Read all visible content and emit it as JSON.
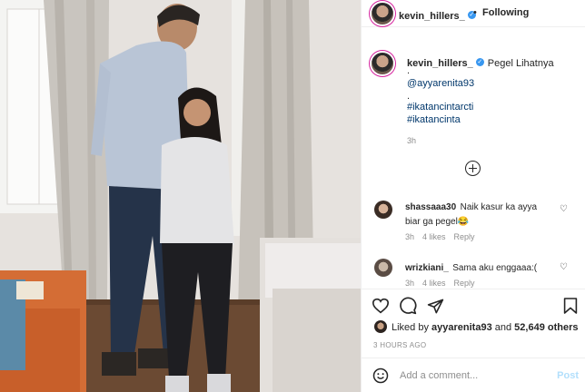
{
  "post": {
    "username": "kevin_hillers_",
    "follow_dot": "•",
    "following_label": "Following",
    "verified_glyph": "✓"
  },
  "caption": {
    "username": "kevin_hillers_",
    "text": "Pegel Lihatnya",
    "dot1": ".",
    "mention": "@ayyarenita93",
    "dot2": ".",
    "hashtag1": "#ikatancintarcti",
    "hashtag2": "#ikatancinta",
    "time": "3h"
  },
  "comments": [
    {
      "username": "shassaaa30",
      "text_line1": "Naik kasur ka ayya",
      "text_line2": "biar ga pegel😂",
      "time": "3h",
      "likes": "4 likes",
      "reply": "Reply"
    },
    {
      "username": "wrizkiani_",
      "text_line1": "Sama aku enggaaa:(",
      "time": "3h",
      "likes": "4 likes",
      "reply": "Reply"
    }
  ],
  "likes": {
    "prefix": "Liked by ",
    "user": "ayyarenita93",
    "middle": " and ",
    "others": "52,649 others"
  },
  "posted_ago": "3 HOURS AGO",
  "add_comment": {
    "placeholder": "Add a comment...",
    "post_label": "Post"
  },
  "icons": {
    "like": "heart-icon",
    "comment": "comment-icon",
    "share": "paper-plane-icon",
    "save": "bookmark-icon",
    "emoji": "emoji-icon",
    "load_more": "plus-circle-icon"
  }
}
